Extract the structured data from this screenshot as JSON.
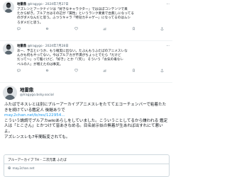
{
  "tweets": [
    {
      "name": "地雷鼎",
      "handle": "@Iragygo",
      "date": "2024年7月27日",
      "lines": [
        "アズレンとアークナイツは「好きなキャラクター」ではほぼコンテンツで来",
        "たから好き。ブルアカはその辺が「属性」というランク要素で台無しになってる",
        "のがダメなんだと思う。ふつうキャラ「特効カチャゲー」になってるのはムシ",
        "ろダメだと思う。"
      ],
      "counts": {
        "reply": "",
        "retweet": "",
        "like": "",
        "views": ""
      }
    },
    {
      "name": "地雷鼎",
      "handle": "@Iragygo",
      "date": "2024年7月28日",
      "lines": [
        "あー、予言というか、もう確実に出ない。たぶんもうふたばのアニメスレな",
        "んかも何もやってない。今はブルアカが不満がちょっとでたら「だけど",
        "だって〜」って騒ぐけど、「好き」とか「（笑）」 そういう「お気の毒なレ",
        "ベルの人」が増えたのは事実。"
      ],
      "counts": {
        "reply": "",
        "retweet": "",
        "like": "",
        "views": ""
      }
    }
  ],
  "bluesky_post": {
    "name": "地雷鼎",
    "handle": "@Iragygo.bsky.social",
    "p1": "ふたばでネスレとは別にブルーアーカイブアニメスレをたててエコーチェンバーで粘着たたきを続けている鑑定人 後継ありで",
    "link": "may.2chan.net/b/res/122954...",
    "p2": "こういう論調でブルアカwikiあらしをしていました。こういうことしてるから嫌われる 鑑定人は「とこさん」とかつけて皆あきなめる。目名前示似の無着が生あれば出すれにて悪いよ。",
    "p3": "アズレンスレも7年間転変されても。",
    "card": {
      "title": "ブルーアーカイブ TH – 二次元裏 ふたば",
      "url": "may.2chan.net"
    }
  },
  "colors": {
    "text": "#0f1419",
    "muted": "#536471",
    "link": "#1d9bf0",
    "border": "#cfd9de"
  },
  "icons": [
    "avatar",
    "more-dots-icon",
    "reply-icon",
    "retweet-icon",
    "like-icon",
    "views-icon",
    "bookmark-icon",
    "share-icon",
    "link-icon"
  ]
}
